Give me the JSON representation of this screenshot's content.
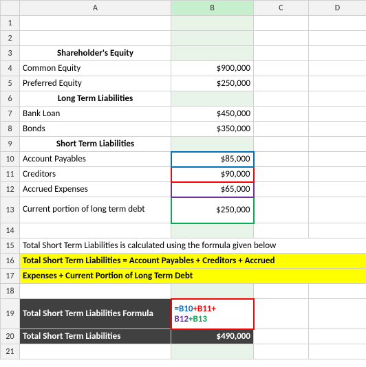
{
  "columns": {
    "row": "",
    "a": "A",
    "b": "B",
    "c": "C",
    "d": "D"
  },
  "rows": {
    "r1": "1",
    "r2": "2",
    "r3": "3",
    "r4": "4",
    "r5": "5",
    "r6": "6",
    "r7": "7",
    "r8": "8",
    "r9": "9",
    "r10": "10",
    "r11": "11",
    "r12": "12",
    "r13": "13",
    "r14": "14",
    "r15": "15",
    "r16": "16",
    "r17": "17",
    "r18": "18",
    "r19": "19",
    "r20": "20",
    "r21": "21"
  },
  "cells": {
    "r3a": "Shareholder's Equity",
    "r4a": "Common Equity",
    "r4b": "$900,000",
    "r5a": "Preferred Equity",
    "r5b": "$250,000",
    "r6a": "Long Term Liabilities",
    "r7a": "Bank Loan",
    "r7b": "$450,000",
    "r8a": "Bonds",
    "r8b": "$350,000",
    "r9a": "Short Term Liabilities",
    "r10a": "Account Payables",
    "r10b": "$85,000",
    "r11a": "Creditors",
    "r11b": "$90,000",
    "r12a": "Accrued Expenses",
    "r12b": "$65,000",
    "r13a": "Current portion of long term debt",
    "r13b": "$250,000",
    "r15a": "Total Short Term Liabilities is calculated using the formula given below",
    "r16a": "Total Short Term Liabilities = Account Payables + Creditors + Accrued",
    "r17a": "Expenses + Current Portion of Long Term Debt",
    "r19a": "Total Short Term Liabilities Formula",
    "r19b_p1": "=B10",
    "r19b_p2": "+B11+",
    "r19b_p3": "B12",
    "r19b_p4": "+B13",
    "r20a": "Total Short Term Liabilities",
    "r20b": "$490,000"
  }
}
